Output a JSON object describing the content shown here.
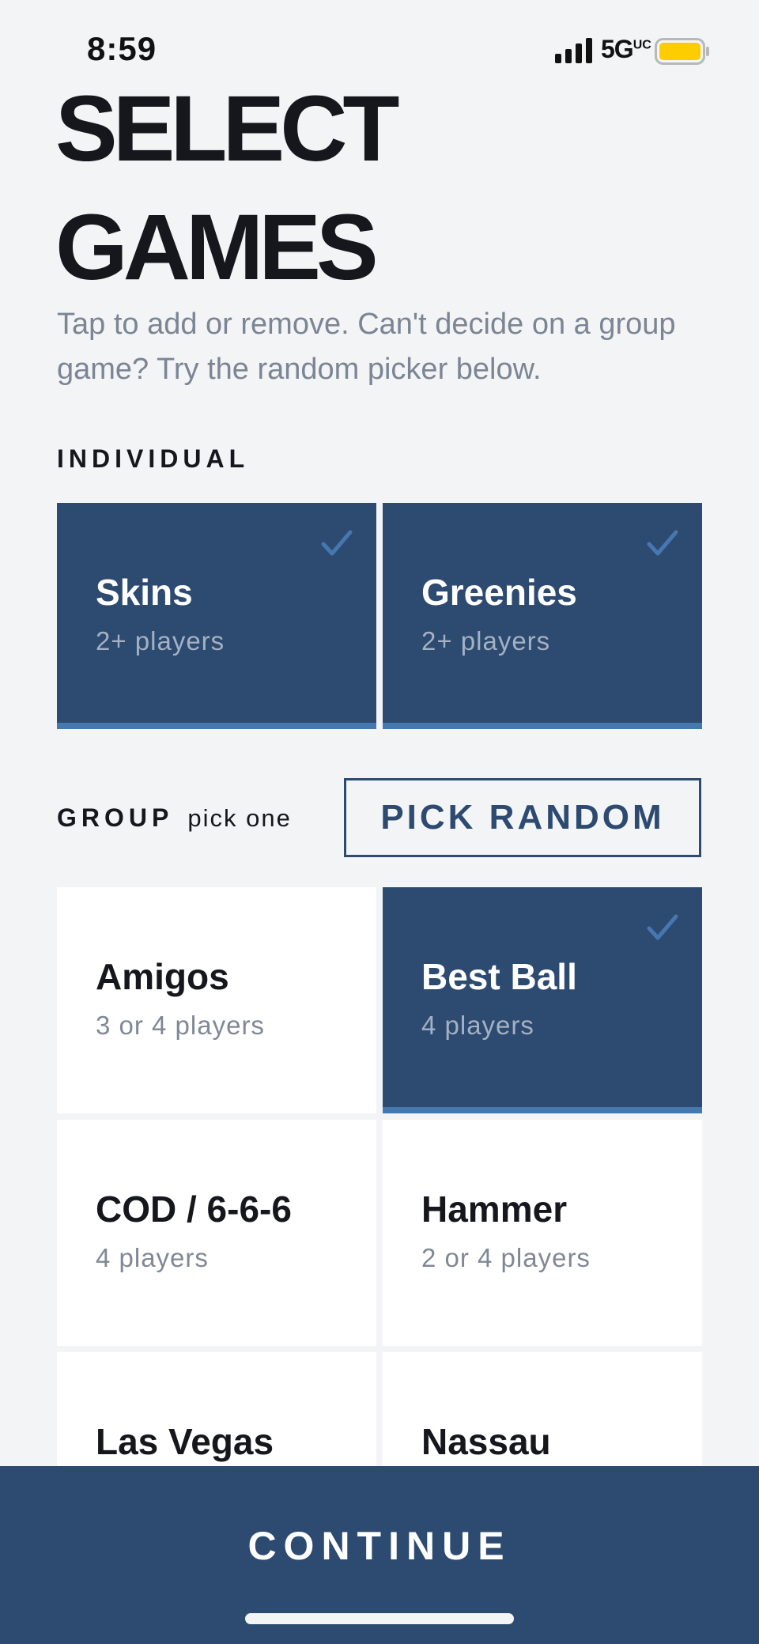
{
  "status_bar": {
    "time": "8:59",
    "network": "5G",
    "network_sup": "UC",
    "signal_icon": "cellular-signal-icon",
    "battery_icon": "battery-icon",
    "battery_color": "#ffcc00"
  },
  "header": {
    "title_line1": "SELECT",
    "title_line2": "GAMES",
    "subtitle": "Tap to add or remove. Can't decide on a group game? Try the random picker below."
  },
  "individual": {
    "label": "INDIVIDUAL",
    "games": [
      {
        "name": "Skins",
        "players": "2+ players",
        "selected": true
      },
      {
        "name": "Greenies",
        "players": "2+ players",
        "selected": true
      }
    ]
  },
  "group": {
    "label": "GROUP",
    "hint": "pick one",
    "pick_random_label": "PICK RANDOM",
    "games": [
      {
        "name": "Amigos",
        "players": "3 or 4 players",
        "selected": false
      },
      {
        "name": "Best Ball",
        "players": "4 players",
        "selected": true
      },
      {
        "name": "COD / 6-6-6",
        "players": "4 players",
        "selected": false
      },
      {
        "name": "Hammer",
        "players": "2 or 4 players",
        "selected": false
      },
      {
        "name": "Las Vegas",
        "players": "",
        "selected": false
      },
      {
        "name": "Nassau",
        "players": "",
        "selected": false
      }
    ]
  },
  "footer": {
    "continue_label": "CONTINUE"
  },
  "colors": {
    "primary": "#2d4a70",
    "accent": "#4678b0",
    "background": "#f3f4f6",
    "card": "#ffffff"
  }
}
